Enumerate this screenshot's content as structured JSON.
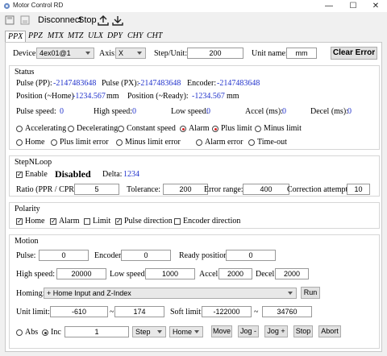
{
  "window": {
    "title": "Motor Control RD",
    "minimize": "—",
    "maximize": "☐",
    "close": "✕"
  },
  "toolbar": {
    "disconnect": "Disconnect",
    "stop": "Stop"
  },
  "tabs": [
    "PPX",
    "PPZ",
    "MTX",
    "MTZ",
    "ULX",
    "DPY",
    "CHY",
    "CHT"
  ],
  "header": {
    "device_label": "Device:",
    "device_value": "4ex01@1",
    "axis_label": "Axis:",
    "axis_value": "X",
    "step_label": "Step/Unit:",
    "step_value": "200",
    "unit_label": "Unit name:",
    "unit_value": "mm",
    "clear_error": "Clear Error"
  },
  "status": {
    "title": "Status",
    "pulse_pp_label": "Pulse (PP):",
    "pulse_pp": "-2147483648",
    "pulse_px_label": "Pulse (PX):",
    "pulse_px": "-2147483648",
    "encoder_label": "Encoder:",
    "encoder": "-2147483648",
    "pos_home_label": "Position (~Home)",
    "pos_home": "-1234.567",
    "pos_home_unit": "mm",
    "pos_ready_label": "Position (~Ready):",
    "pos_ready": "-1234.567",
    "pos_ready_unit": "mm",
    "pulse_speed_label": "Pulse speed:",
    "pulse_speed": "0",
    "high_speed_label": "High speed:",
    "high_speed": "0",
    "low_speed_label": "Low speed:",
    "low_speed": "0",
    "accel_label": "Accel (ms):",
    "accel": "0",
    "decel_label": "Decel (ms):",
    "decel": "0",
    "flags1": [
      "Accelerating",
      "Decelerating",
      "Constant speed",
      "Alarm",
      "Plus limit",
      "Minus limit"
    ],
    "flags2": [
      "Home",
      "Plus limit error",
      "Minus limit error",
      "Alarm error",
      "Time-out"
    ]
  },
  "stepnloop": {
    "title": "StepNLoop",
    "enable": "Enable",
    "state": "Disabled",
    "delta_label": "Delta:",
    "delta": "1234",
    "ratio_label": "Ratio (PPR / CPR):",
    "ratio": "5",
    "tolerance_label": "Tolerance:",
    "tolerance": "200",
    "error_range_label": "Error range:",
    "error_range": "400",
    "correction_label": "Correction attempt:",
    "correction": "10"
  },
  "polarity": {
    "title": "Polarity",
    "items": [
      "Home",
      "Alarm",
      "Limit",
      "Pulse direction",
      "Encoder direction"
    ]
  },
  "motion": {
    "title": "Motion",
    "pulse_label": "Pulse:",
    "pulse": "0",
    "encoder_label": "Encoder:",
    "encoder": "0",
    "ready_label": "Ready position:",
    "ready": "0",
    "high_label": "High speed:",
    "high": "20000",
    "low_label": "Low speed:",
    "low": "1000",
    "accel_label": "Accel:",
    "accel": "2000",
    "decel_label": "Decel:",
    "decel": "2000",
    "homing_label": "Homing:",
    "homing_value": "+ Home Input and Z-Index",
    "run": "Run",
    "unit_limit_label": "Unit limit:",
    "unit_limit_min": "-610",
    "unit_limit_max": "174",
    "tilde": "~",
    "soft_limit_label": "Soft limit:",
    "soft_limit_min": "-122000",
    "soft_limit_max": "34760",
    "abs": "Abs",
    "inc": "Inc",
    "amount": "1",
    "step_mode": "Step",
    "home_mode": "Home",
    "move": "Move",
    "jog_minus": "Jog -",
    "jog_plus": "Jog +",
    "stop": "Stop",
    "abort": "Abort"
  }
}
